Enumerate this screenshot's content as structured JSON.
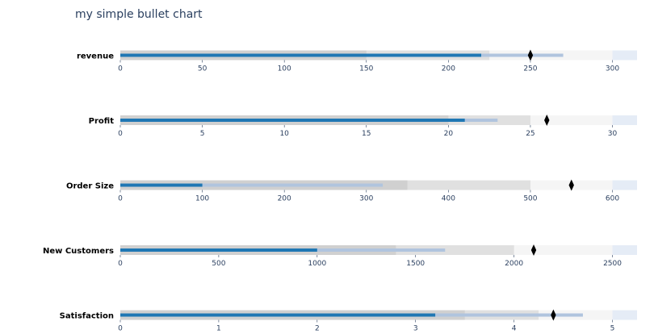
{
  "chart_data": {
    "type": "bullet",
    "title": "my simple bullet chart",
    "colors": {
      "range_bands": [
        "#e5ecf6",
        "#f5f5f5",
        "#e0e0e0",
        "#d0d0d0"
      ],
      "measure_primary": "#1f77b4",
      "measure_secondary": "#b0c4de",
      "marker": "#000000"
    },
    "bullets": [
      {
        "label": "revenue",
        "xlim": [
          0,
          315
        ],
        "ticks": [
          0,
          50,
          100,
          150,
          200,
          250,
          300
        ],
        "ranges": [
          150,
          225,
          300
        ],
        "measures": [
          220,
          270
        ],
        "marker": 250
      },
      {
        "label": "Profit",
        "xlim": [
          0,
          31.5
        ],
        "ticks": [
          0,
          5,
          10,
          15,
          20,
          25,
          30
        ],
        "ranges": [
          20,
          25,
          30
        ],
        "measures": [
          21,
          23
        ],
        "marker": 26
      },
      {
        "label": "Order Size",
        "xlim": [
          0,
          630
        ],
        "ticks": [
          0,
          100,
          200,
          300,
          400,
          500,
          600
        ],
        "ranges": [
          350,
          500,
          600
        ],
        "measures": [
          100,
          320
        ],
        "marker": 550
      },
      {
        "label": "New Customers",
        "xlim": [
          0,
          2625
        ],
        "ticks": [
          0,
          500,
          1000,
          1500,
          2000,
          2500
        ],
        "ranges": [
          1400,
          2000,
          2500
        ],
        "measures": [
          1000,
          1650
        ],
        "marker": 2100
      },
      {
        "label": "Satisfaction",
        "xlim": [
          0,
          5.25
        ],
        "ticks": [
          0,
          1,
          2,
          3,
          4,
          5
        ],
        "ranges": [
          3.5,
          4.25,
          5
        ],
        "measures": [
          3.2,
          4.7
        ],
        "marker": 4.4
      }
    ]
  }
}
